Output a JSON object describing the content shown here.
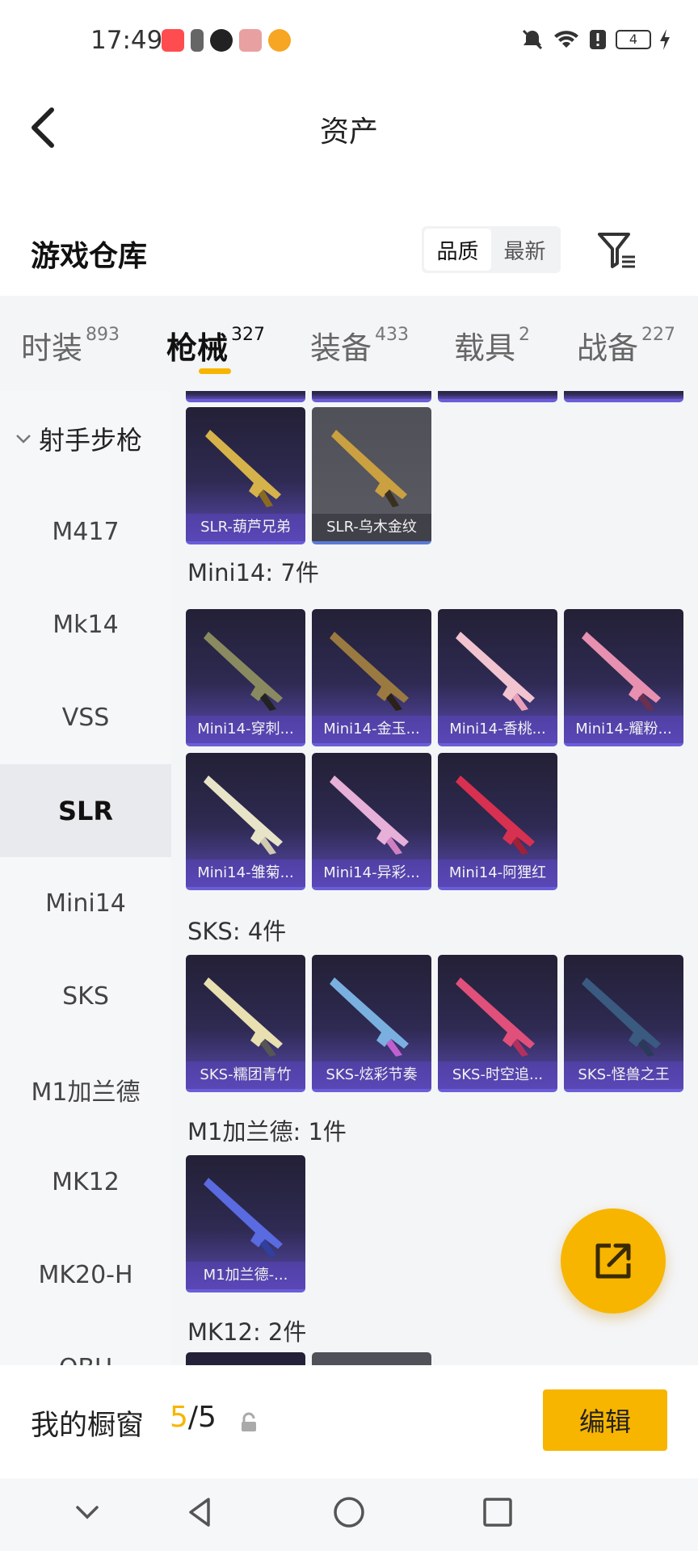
{
  "status_bar": {
    "time": "17:49",
    "battery": "4",
    "left_icons": [
      "app-icon-red",
      "battery-saver-icon",
      "qq-icon",
      "app-icon-box",
      "app-icon-yellow"
    ],
    "right_icons": [
      "mute-icon",
      "wifi-icon",
      "alert-icon",
      "battery-icon",
      "charging-icon"
    ]
  },
  "header": {
    "title": "资产",
    "back_icon": "back-arrow-icon"
  },
  "warehouse": {
    "title": "游戏仓库",
    "sort_options": [
      "品质",
      "最新"
    ],
    "active_sort": "品质",
    "filter_icon": "filter-icon"
  },
  "tabs": [
    {
      "label": "时装",
      "count": "893"
    },
    {
      "label": "枪械",
      "count": "327"
    },
    {
      "label": "装备",
      "count": "433"
    },
    {
      "label": "载具",
      "count": "2"
    },
    {
      "label": "战备",
      "count": "227"
    }
  ],
  "active_tab": "枪械",
  "sidebar": {
    "category": "射手步枪",
    "items": [
      "M417",
      "Mk14",
      "VSS",
      "SLR",
      "Mini14",
      "SKS",
      "M1加兰德",
      "MK12",
      "MK20-H",
      "QBU"
    ],
    "active": "SLR"
  },
  "content": {
    "slr_items": [
      "SLR-葫芦兄弟",
      "SLR-乌木金纹"
    ],
    "groups": [
      {
        "title": "Mini14: 7件",
        "items": [
          "Mini14-穿刺...",
          "Mini14-金玉...",
          "Mini14-香桃...",
          "Mini14-耀粉...",
          "Mini14-雏菊...",
          "Mini14-异彩...",
          "Mini14-阿狸红"
        ]
      },
      {
        "title": "SKS: 4件",
        "items": [
          "SKS-糯团青竹",
          "SKS-炫彩节奏",
          "SKS-时空追...",
          "SKS-怪兽之王"
        ]
      },
      {
        "title": "M1加兰德: 1件",
        "items": [
          "M1加兰德-..."
        ]
      },
      {
        "title": "MK12: 2件",
        "items": []
      }
    ]
  },
  "colors": {
    "accent": "#f7b500",
    "card_purple": "#5a4ab0",
    "card_grey": "#55555d"
  },
  "bottom": {
    "showcase_label": "我的橱窗",
    "showcase_current": "5",
    "showcase_total": "/5",
    "edit_label": "编辑"
  },
  "fab_icon": "share-export-icon",
  "nav_icons": [
    "hide-keyboard-icon",
    "back-triangle-icon",
    "home-circle-icon",
    "recents-square-icon"
  ]
}
